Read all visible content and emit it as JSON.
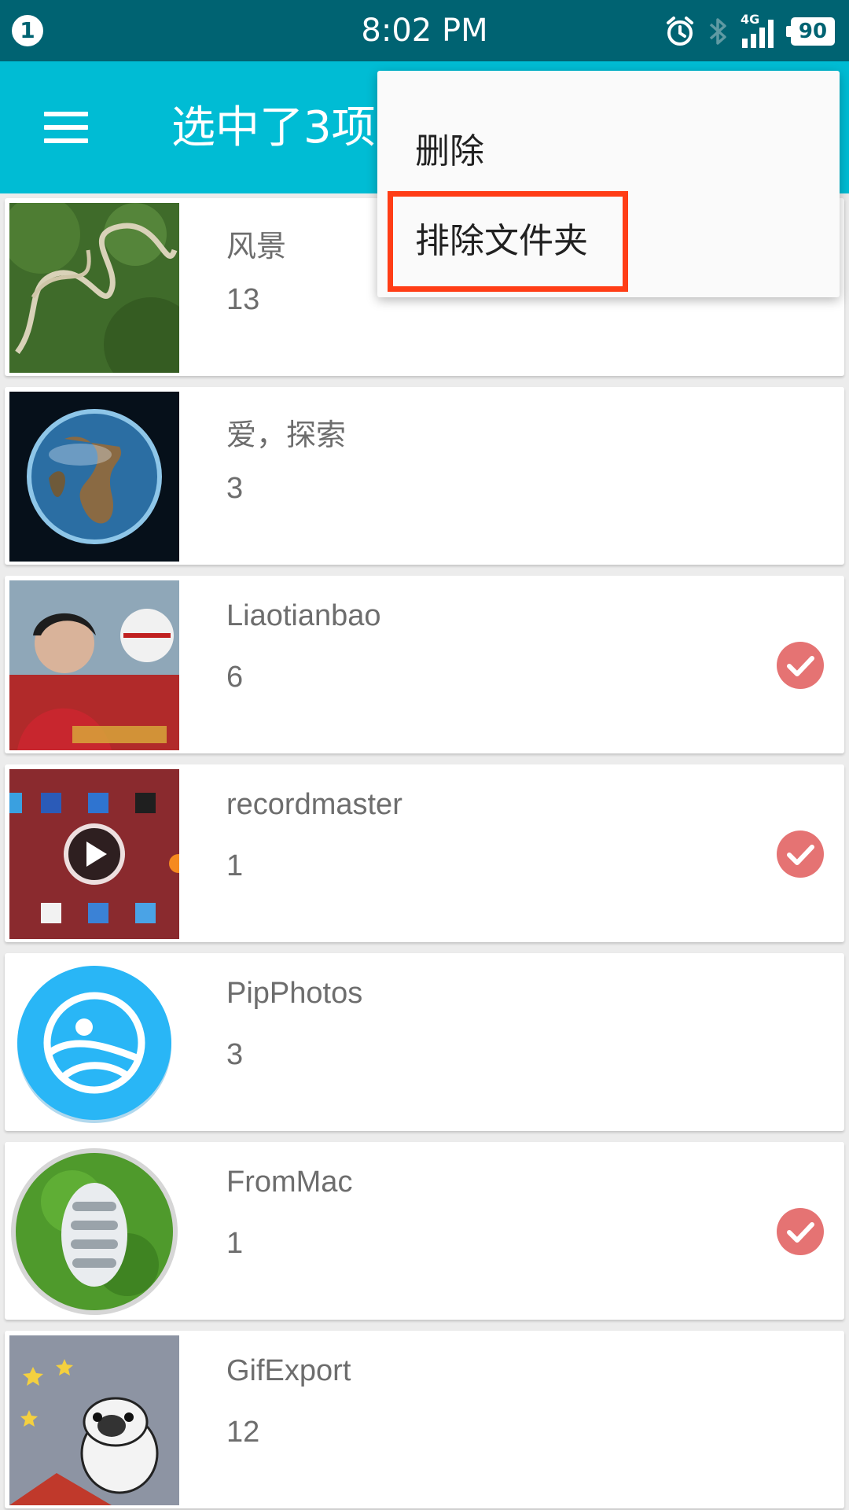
{
  "status_bar": {
    "notification_count": "1",
    "time": "8:02 PM",
    "network": "4G",
    "battery": "90",
    "icons": [
      "alarm-icon",
      "bluetooth-icon",
      "signal-icon",
      "battery-icon"
    ]
  },
  "app_bar": {
    "title": "选中了3项",
    "menu_icon": "hamburger-menu-icon"
  },
  "popup_menu": {
    "items": [
      {
        "label": "删除"
      },
      {
        "label": "排除文件夹",
        "highlighted": true
      }
    ]
  },
  "folders": [
    {
      "name": "风景",
      "count": "13",
      "selected": false,
      "thumb": "landscape-road-thumbnail"
    },
    {
      "name": "爱，探索",
      "count": "3",
      "selected": false,
      "thumb": "earth-thumbnail"
    },
    {
      "name": "Liaotianbao",
      "count": "6",
      "selected": true,
      "thumb": "racer-poster-thumbnail"
    },
    {
      "name": "recordmaster",
      "count": "1",
      "selected": true,
      "thumb": "video-screen-recording-thumbnail"
    },
    {
      "name": "PipPhotos",
      "count": "3",
      "selected": false,
      "thumb": "pipphotos-app-icon"
    },
    {
      "name": "FromMac",
      "count": "1",
      "selected": true,
      "thumb": "grass-footprint-thumbnail"
    },
    {
      "name": "GifExport",
      "count": "12",
      "selected": false,
      "thumb": "pug-cartoon-thumbnail"
    }
  ],
  "colors": {
    "status_bar": "#006372",
    "app_bar": "#00bcd4",
    "check": "#e57373",
    "highlight": "#ff3d16"
  }
}
